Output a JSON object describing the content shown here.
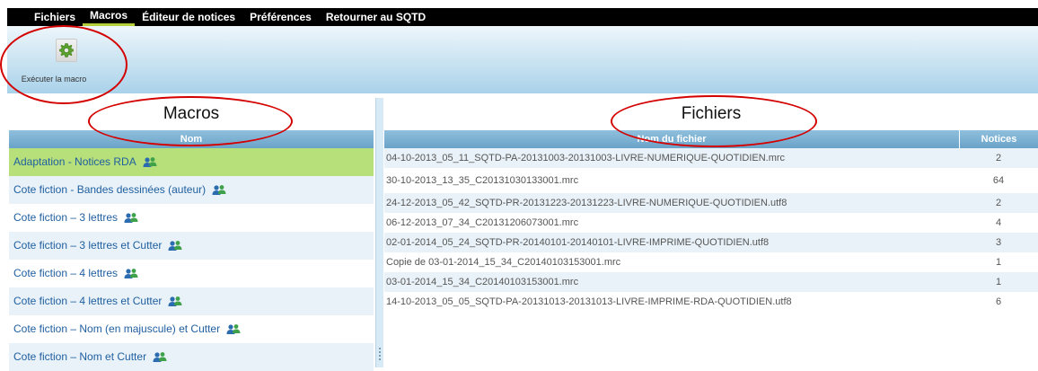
{
  "menu": [
    {
      "label": "Fichiers",
      "active": false
    },
    {
      "label": "Macros",
      "active": true
    },
    {
      "label": "Éditeur de notices",
      "active": false
    },
    {
      "label": "Préférences",
      "active": false
    },
    {
      "label": "Retourner au SQTD",
      "active": false
    }
  ],
  "toolbar": {
    "run_macro_label": "Exécuter la macro",
    "run_macro_icon": "gear-icon"
  },
  "macros": {
    "title": "Macros",
    "column": "Nom",
    "items": [
      {
        "label": "Adaptation - Notices RDA",
        "icon": "users-icon"
      },
      {
        "label": "Cote fiction - Bandes dessinées (auteur)",
        "icon": "users-icon"
      },
      {
        "label": "Cote fiction – 3 lettres",
        "icon": "users-icon"
      },
      {
        "label": "Cote fiction – 3 lettres et Cutter",
        "icon": "users-icon"
      },
      {
        "label": "Cote fiction – 4 lettres",
        "icon": "users-icon"
      },
      {
        "label": "Cote fiction – 4 lettres et Cutter",
        "icon": "users-icon"
      },
      {
        "label": "Cote fiction – Nom (en majuscule) et Cutter",
        "icon": "users-icon"
      },
      {
        "label": "Cote fiction – Nom et Cutter",
        "icon": "users-icon"
      }
    ],
    "selected_index": 0
  },
  "files": {
    "title": "Fichiers",
    "columns": [
      "Nom du fichier",
      "Notices"
    ],
    "rows": [
      {
        "name": "04-10-2013_05_11_SQTD-PA-20131003-20131003-LIVRE-NUMERIQUE-QUOTIDIEN.mrc",
        "count": "2"
      },
      {
        "name": "30-10-2013_13_35_C20131030133001.mrc",
        "count": "64"
      },
      {
        "name": "24-12-2013_05_42_SQTD-PR-20131223-20131223-LIVRE-NUMERIQUE-QUOTIDIEN.utf8",
        "count": "2"
      },
      {
        "name": "06-12-2013_07_34_C20131206073001.mrc",
        "count": "4"
      },
      {
        "name": "02-01-2014_05_24_SQTD-PR-20140101-20140101-LIVRE-IMPRIME-QUOTIDIEN.utf8",
        "count": "3"
      },
      {
        "name": "Copie de 03-01-2014_15_34_C20140103153001.mrc",
        "count": "1"
      },
      {
        "name": "03-01-2014_15_34_C20140103153001.mrc",
        "count": "1"
      },
      {
        "name": "14-10-2013_05_05_SQTD-PA-20131013-20131013-LIVRE-IMPRIME-RDA-QUOTIDIEN.utf8",
        "count": "6"
      }
    ]
  },
  "colors": {
    "menu_bg": "#000000",
    "accent": "#b5cf3c",
    "header_bg": "#6aa3c9",
    "selected_row": "#b7e07a",
    "annotation": "#d40000"
  }
}
